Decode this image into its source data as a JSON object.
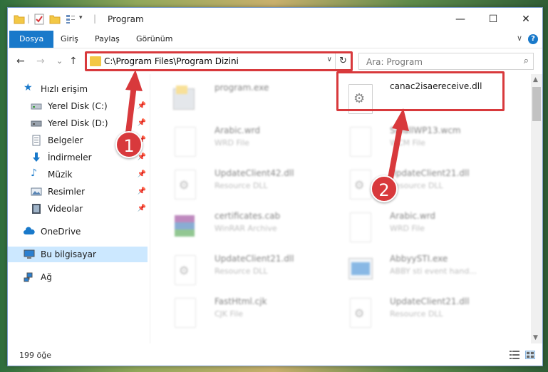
{
  "window": {
    "title": "Program",
    "controls": {
      "minimize": "—",
      "maximize": "☐",
      "close": "✕"
    }
  },
  "ribbon": {
    "tabs": [
      "Dosya",
      "Giriş",
      "Paylaş",
      "Görünüm"
    ],
    "expand": "∨",
    "help": "?"
  },
  "nav": {
    "back": "←",
    "forward": "→",
    "recent": "⌄",
    "up": "↑",
    "address": "C:\\Program Files\\Program Dizini",
    "refresh": "↻",
    "search_placeholder": "Ara: Program"
  },
  "sidebar": {
    "items": [
      {
        "label": "Hızlı erişim",
        "icon": "star-icon",
        "pinned": false
      },
      {
        "label": "Yerel Disk (C:)",
        "icon": "drive-icon",
        "pinned": true
      },
      {
        "label": "Yerel Disk (D:)",
        "icon": "drive-icon",
        "pinned": true
      },
      {
        "label": "Belgeler",
        "icon": "documents-icon",
        "pinned": true
      },
      {
        "label": "İndirmeler",
        "icon": "download-icon",
        "pinned": true
      },
      {
        "label": "Müzik",
        "icon": "music-icon",
        "pinned": true
      },
      {
        "label": "Resimler",
        "icon": "pictures-icon",
        "pinned": true
      },
      {
        "label": "Videolar",
        "icon": "videos-icon",
        "pinned": true
      },
      {
        "label": "OneDrive",
        "icon": "cloud-icon",
        "pinned": false
      },
      {
        "label": "Bu bilgisayar",
        "icon": "computer-icon",
        "pinned": false
      },
      {
        "label": "Ağ",
        "icon": "network-icon",
        "pinned": false
      }
    ]
  },
  "files": [
    {
      "name": "program.exe",
      "type": "",
      "icon": "exe-icon",
      "blurred": true
    },
    {
      "name": "canac2isaereceive.dll",
      "type": "",
      "icon": "dll-icon",
      "blurred": false
    },
    {
      "name": "Arabic.wrd",
      "type": "WRD File",
      "icon": "file-icon",
      "blurred": true
    },
    {
      "name": "SmallWP13.wcm",
      "type": "WCM File",
      "icon": "file-icon",
      "blurred": true
    },
    {
      "name": "UpdateClient42.dll",
      "type": "Resource DLL",
      "icon": "dll-icon",
      "blurred": true
    },
    {
      "name": "UpdateClient21.dll",
      "type": "Resource DLL",
      "icon": "dll-icon",
      "blurred": true
    },
    {
      "name": "certificates.cab",
      "type": "WinRAR Archive",
      "icon": "archive-icon",
      "blurred": true
    },
    {
      "name": "Arabic.wrd",
      "type": "WRD File",
      "icon": "file-icon",
      "blurred": true
    },
    {
      "name": "UpdateClient21.dll",
      "type": "Resource DLL",
      "icon": "dll-icon",
      "blurred": true
    },
    {
      "name": "AbbyySTI.exe",
      "type": "ABBY sti event hand...",
      "icon": "exe-icon",
      "blurred": true
    },
    {
      "name": "FastHtml.cjk",
      "type": "CJK File",
      "icon": "file-icon",
      "blurred": true
    },
    {
      "name": "UpdateClient21.dll",
      "type": "Resource DLL",
      "icon": "dll-icon",
      "blurred": true
    }
  ],
  "callouts": [
    "1",
    "2"
  ],
  "status": {
    "count": "199 öğe"
  },
  "colors": {
    "accent": "#1979ca",
    "highlight": "#d8393c",
    "selected": "#cce8ff"
  }
}
